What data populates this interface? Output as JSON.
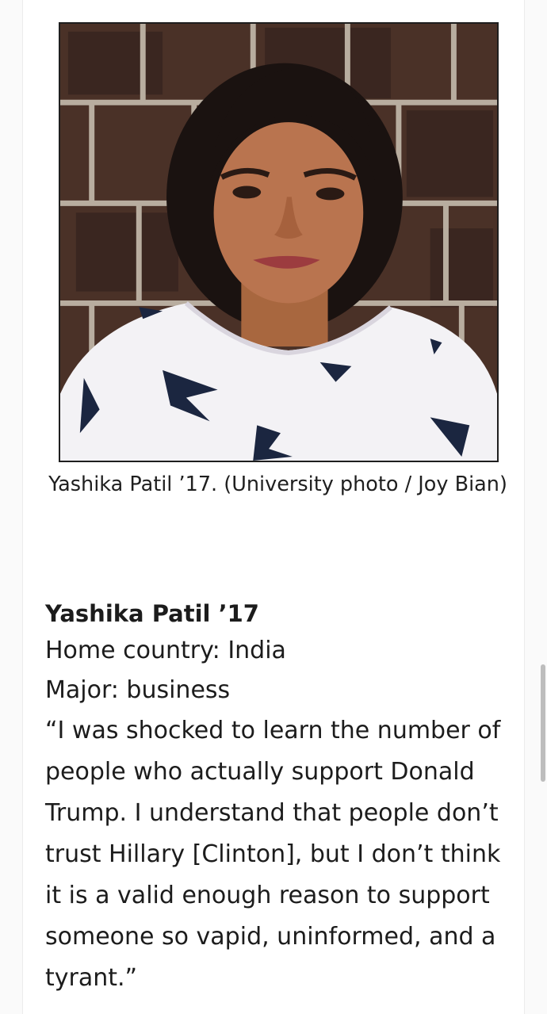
{
  "photo": {
    "alt": "Yashika Patil"
  },
  "caption": "Yashika Patil ’17. (University photo / Joy Bian)",
  "profile": {
    "name": "Yashika Patil ’17",
    "home_country": "Home country: India",
    "major": "Major: business",
    "quote": "“I was shocked to learn the number of people who actually support Donald Trump. I understand that people don’t trust Hillary [Clinton], but I don’t think it is a valid enough reason to support someone so vapid, uninformed, and a tyrant.”"
  },
  "colors": {
    "brick": "#4a3127",
    "mortar": "#b8ad9f",
    "shirt": "#f3f2f5",
    "print": "#1b2640",
    "hair": "#1a1210",
    "skin": "#b9744f"
  }
}
